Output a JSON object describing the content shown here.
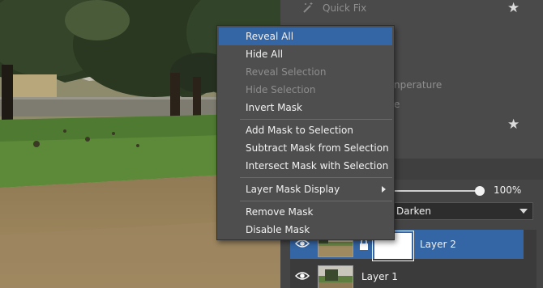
{
  "context_menu": {
    "items": [
      {
        "label": "Reveal All",
        "state": "highlighted"
      },
      {
        "label": "Hide All",
        "state": "enabled"
      },
      {
        "label": "Reveal Selection",
        "state": "disabled"
      },
      {
        "label": "Hide Selection",
        "state": "disabled"
      },
      {
        "label": "Invert Mask",
        "state": "enabled"
      },
      {
        "label": "Add Mask to Selection",
        "state": "enabled"
      },
      {
        "label": "Subtract Mask from Selection",
        "state": "enabled"
      },
      {
        "label": "Intersect Mask with Selection",
        "state": "enabled"
      },
      {
        "label": "Layer Mask Display",
        "state": "enabled",
        "submenu": true
      },
      {
        "label": "Remove Mask",
        "state": "enabled"
      },
      {
        "label": "Disable Mask",
        "state": "enabled"
      }
    ]
  },
  "effects_panel": {
    "quick_fix_label": "Quick Fix",
    "partial_label_1": "nperature",
    "partial_label_2": "e",
    "quick_fix_icon": "wand-icon",
    "favorite_icon": "star-icon"
  },
  "layers_panel": {
    "opacity_value": "100%",
    "opacity_level": 1.0,
    "blend_mode": "Darken",
    "layers": [
      {
        "name": "Layer 2",
        "selected": true,
        "visible": true,
        "locked": true,
        "has_mask": true
      },
      {
        "name": "Layer 1",
        "selected": false,
        "visible": true,
        "locked": false,
        "has_mask": false
      }
    ]
  },
  "colors": {
    "accent": "#3465a4",
    "menu_bg": "#4e4e4e",
    "panel_bg": "#454545"
  }
}
